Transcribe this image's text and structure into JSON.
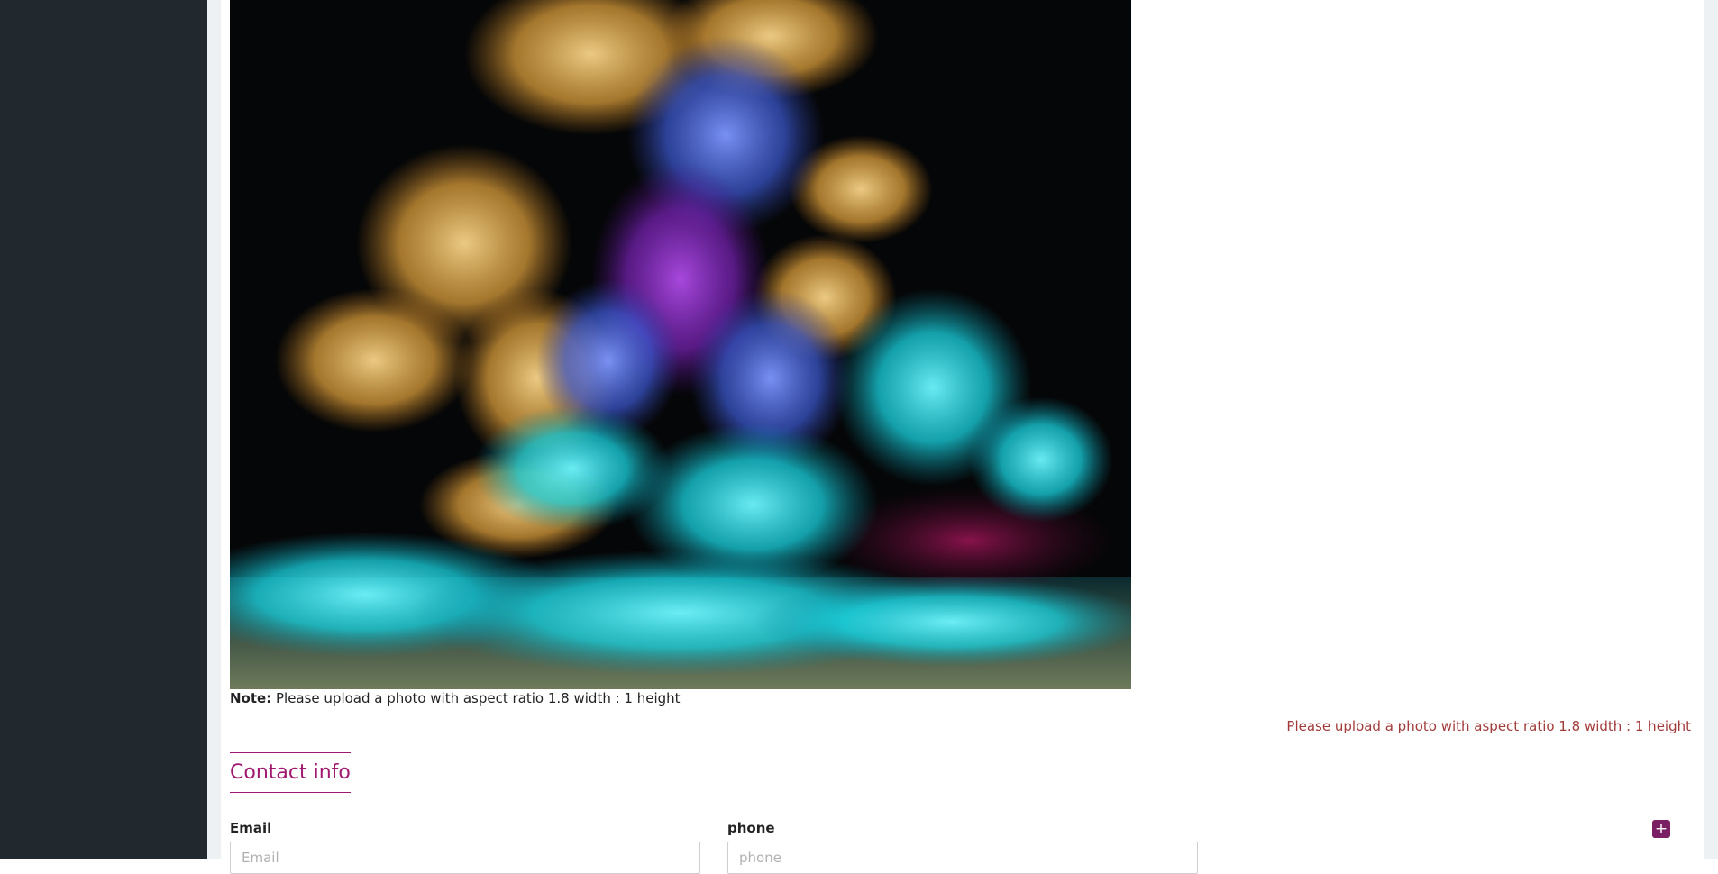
{
  "photo": {
    "kind": "colorful ink smoke in water on black background"
  },
  "note": {
    "prefix": "Note:",
    "text": "Please upload a photo with aspect ratio 1.8 width : 1 height"
  },
  "validation_error": "Please upload a photo with aspect ratio 1.8 width : 1 height",
  "contact_section": {
    "title": "Contact info",
    "email_label": "Email",
    "email_placeholder": "Email",
    "phone_label": "phone",
    "phone_placeholder": "phone",
    "add_icon": "plus-icon"
  },
  "colors": {
    "sidebar": "#21292e",
    "accent": "#a0186f",
    "button": "#7a1f63",
    "error": "#a33a3a"
  }
}
